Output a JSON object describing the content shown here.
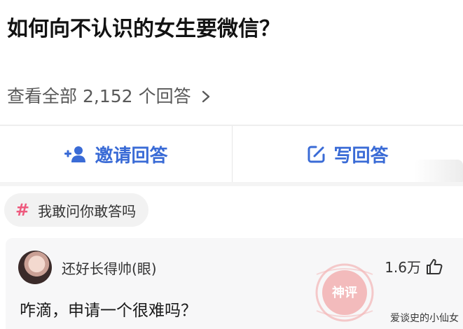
{
  "question": {
    "title": "如何向不认识的女生要微信？",
    "view_all_prefix": "查看全部",
    "answer_count": "2,152",
    "view_all_suffix": "个回答"
  },
  "actions": {
    "invite_label": "邀请回答",
    "write_label": "写回答"
  },
  "topic": {
    "label": "我敢问你敢答吗"
  },
  "answer": {
    "author": "还好长得帅(眼)",
    "likes": "1.6万",
    "text": "咋滴，申请一个很难吗？",
    "stamp_text": "神评"
  },
  "watermark": "爱谈史的小仙女",
  "colors": {
    "accent_blue": "#3a6bd6",
    "topic_pink": "#ee5a7e",
    "stamp_red": "#f08a8a"
  }
}
